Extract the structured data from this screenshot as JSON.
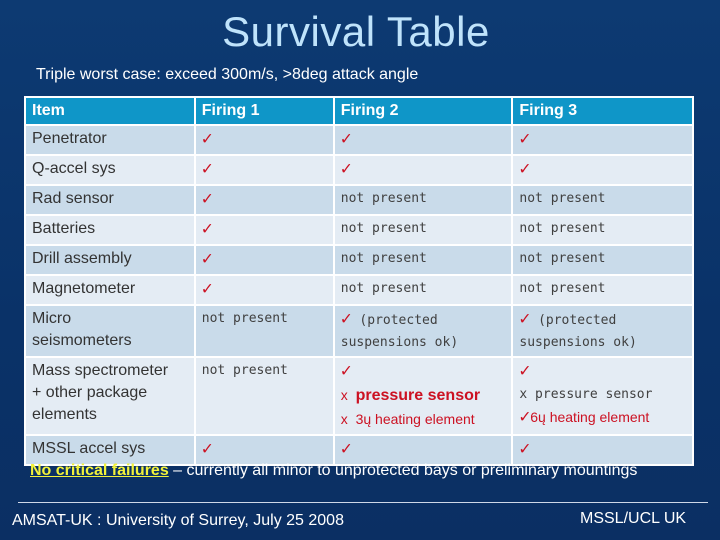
{
  "slide": {
    "title": "Survival Table",
    "subtitle": "Triple worst case: exceed 300m/s, >8deg attack angle"
  },
  "table": {
    "headers": [
      "Item",
      "Firing 1",
      "Firing 2",
      "Firing 3"
    ],
    "check": "✓",
    "not_present": "not present",
    "rows": [
      {
        "item": "Penetrator",
        "f1": "✓",
        "f2": "✓",
        "f3": "✓"
      },
      {
        "item": "Q-accel sys",
        "f1": "✓",
        "f2": "✓",
        "f3": "✓"
      },
      {
        "item": "Rad sensor",
        "f1": "✓",
        "f2": "not present",
        "f3": "not present"
      },
      {
        "item": "Batteries",
        "f1": "✓",
        "f2": "not present",
        "f3": "not present"
      },
      {
        "item": "Drill assembly",
        "f1": "✓",
        "f2": "not present",
        "f3": "not present"
      },
      {
        "item": "Magnetometer",
        "f1": "✓",
        "f2": "not present",
        "f3": "not present"
      },
      {
        "item_line1": "Micro",
        "item_line2": "seismometers",
        "f1": "not present",
        "f2_check": "✓",
        "f2_line1": "(protected",
        "f2_line2": "suspensions ok)",
        "f3_check": "✓",
        "f3_line1": "(protected",
        "f3_line2": "suspensions ok)"
      },
      {
        "item_line1": "Mass spectrometer",
        "item_line2": "+ other package",
        "item_line3": "elements",
        "f1": "not present",
        "f2_check": "✓",
        "f2_line2_mark": "x",
        "f2_line2": "pressure sensor",
        "f2_line3_mark": "x",
        "f2_line3": "3ų heating  element",
        "f3_check": "✓",
        "f3_line2_mark": "x",
        "f3_line2": "pressure sensor",
        "f3_line3_mark": "✓",
        "f3_line3": "6ų heating element"
      },
      {
        "item": "MSSL accel sys",
        "f1": "✓",
        "f2": "✓",
        "f3": "✓"
      }
    ]
  },
  "note": {
    "highlight": "No critical failures",
    "rest": " – currently all minor to unprotected bays or preliminary mountings"
  },
  "footer": {
    "left": "AMSAT-UK :  University of Surrey, July 25 2008",
    "right": "MSSL/UCL UK"
  },
  "colors": {
    "background": "#0a3268",
    "title": "#bfe3fb",
    "header": "#0f96c8",
    "row_a": "#c9dbea",
    "row_b": "#e4ecf4",
    "check": "#cc1122",
    "highlight": "#f2f23a"
  }
}
